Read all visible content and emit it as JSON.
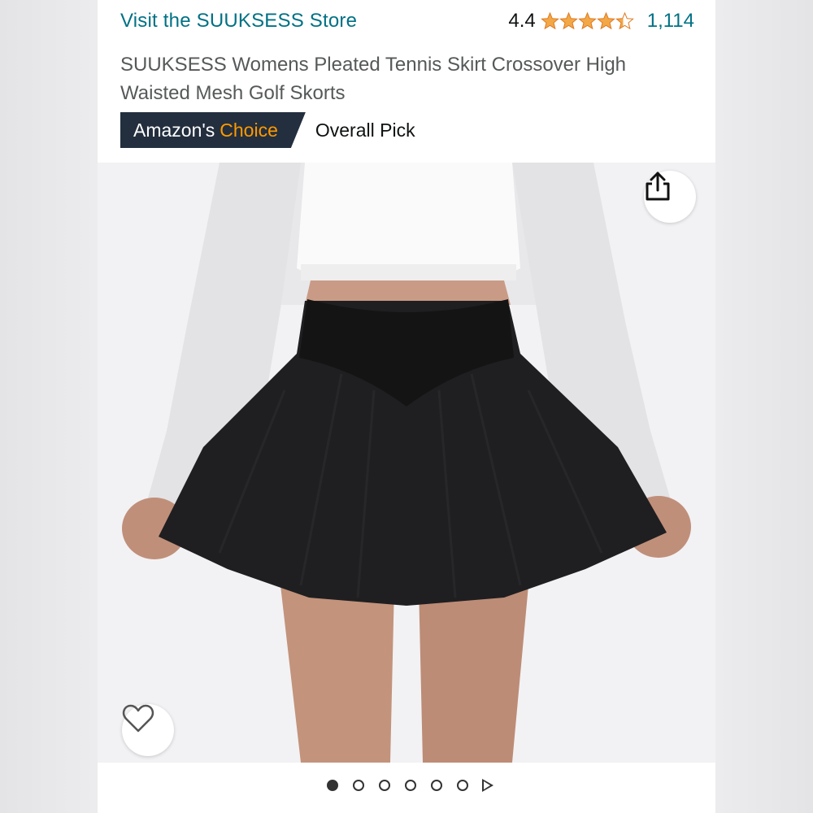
{
  "store": {
    "link_text": "Visit the SUUKSESS Store"
  },
  "rating": {
    "score": "4.4",
    "stars_value": 4.4,
    "stars_max": 5,
    "review_count": "1,114"
  },
  "product": {
    "title": "SUUKSESS Womens Pleated Tennis Skirt Crossover High Waisted Mesh Golf Skorts"
  },
  "badge": {
    "prefix": "Amazon's",
    "highlight": "Choice",
    "label": "Overall Pick"
  },
  "gallery": {
    "image_count": 6,
    "active_index": 0,
    "has_video": true
  },
  "icons": {
    "share": "share-icon",
    "favorite": "heart-icon",
    "video": "play-icon"
  },
  "colors": {
    "link": "#007185",
    "badge_bg": "#232f3e",
    "badge_accent": "#ff9900",
    "star": "#f3a847"
  }
}
